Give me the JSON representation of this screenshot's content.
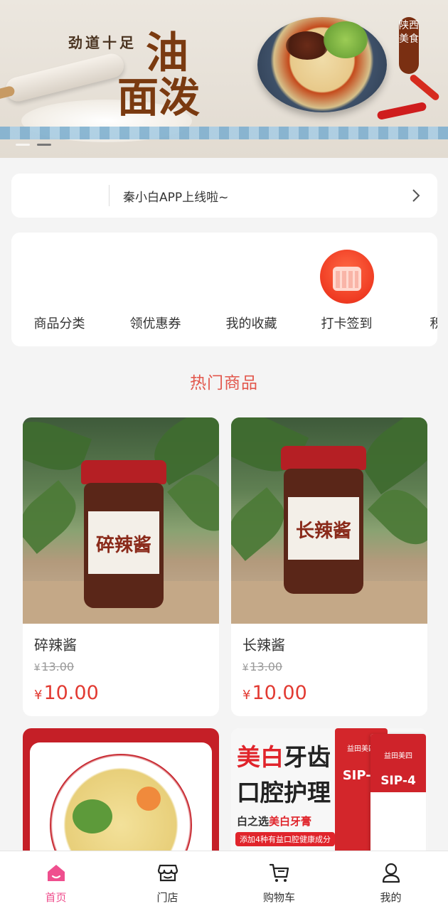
{
  "banner": {
    "slogan": "劲道十足",
    "title_line1": "油",
    "title_line2": "面泼",
    "stamp": "陕西美食",
    "slide_count": 2,
    "active_slide": 2
  },
  "notice": {
    "text": "秦小白APP上线啦~"
  },
  "menu": {
    "items": [
      {
        "label": "商品分类",
        "icon": "category-icon"
      },
      {
        "label": "领优惠券",
        "icon": "coupon-icon"
      },
      {
        "label": "我的收藏",
        "icon": "favorite-icon"
      },
      {
        "label": "打卡签到",
        "icon": "checkin-calendar-icon"
      },
      {
        "label": "积分",
        "icon": "points-icon"
      }
    ]
  },
  "hot": {
    "title": "热门商品",
    "products": [
      {
        "name": "碎辣酱",
        "currency": "¥",
        "original_price": "13.00",
        "price": "10.00",
        "jar_label": "碎辣酱"
      },
      {
        "name": "长辣酱",
        "currency": "¥",
        "original_price": "13.00",
        "price": "10.00",
        "jar_label": "长辣酱"
      }
    ],
    "tooth_ad": {
      "line1_red": "美白",
      "line1_black": "牙齿",
      "line2": "口腔护理",
      "line3_prefix": "白之选",
      "line3_red": "美白牙膏",
      "line4": "添加4种有益口腔健康成分",
      "brand": "益田美四",
      "product": "SIP-4"
    }
  },
  "tabbar": {
    "items": [
      {
        "label": "首页",
        "icon": "home-icon",
        "active": true
      },
      {
        "label": "门店",
        "icon": "store-icon",
        "active": false
      },
      {
        "label": "购物车",
        "icon": "cart-icon",
        "active": false
      },
      {
        "label": "我的",
        "icon": "user-icon",
        "active": false
      }
    ],
    "active_color": "#ef4f8e"
  },
  "colors": {
    "accent_red": "#e23a32",
    "hot_title": "#e2574c"
  }
}
